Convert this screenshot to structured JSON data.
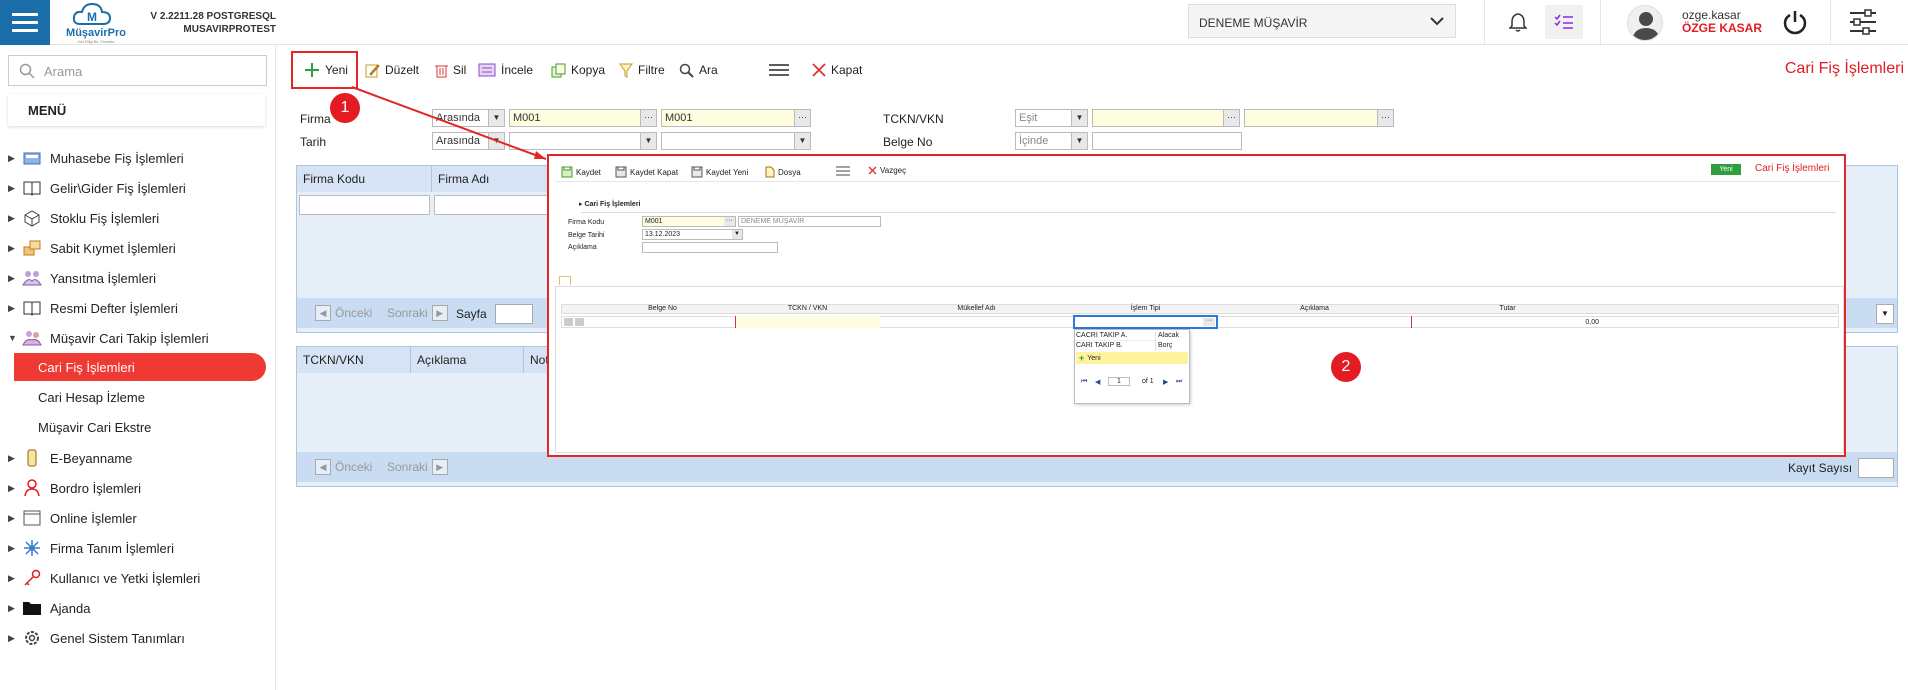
{
  "header": {
    "version_line1": "V 2.2211.28 POSTGRESQL",
    "version_line2": "MUSAVIRPROTEST",
    "brand": "MüşavirPro",
    "brand_tag": "Her Bilgi Bir Yönetim",
    "firm_select": "DENEME MÜŞAVİR",
    "user_login": "ozge.kasar",
    "user_full": "ÖZGE KASAR"
  },
  "sidebar": {
    "search_placeholder": "Arama",
    "menu_title": "MENÜ",
    "items": [
      {
        "label": "Muhasebe Fiş İşlemleri",
        "icon": "calculator-icon"
      },
      {
        "label": "Gelir\\Gider Fiş İşlemleri",
        "icon": "book-icon"
      },
      {
        "label": "Stoklu Fiş İşlemleri",
        "icon": "box-icon"
      },
      {
        "label": "Sabit Kıymet İşlemleri",
        "icon": "assets-icon"
      },
      {
        "label": "Yansıtma İşlemleri",
        "icon": "reflect-icon"
      },
      {
        "label": "Resmi Defter İşlemleri",
        "icon": "ledger-icon"
      },
      {
        "label": "Müşavir Cari Takip İşlemleri",
        "icon": "users-icon"
      },
      {
        "label": "E-Beyanname",
        "icon": "phone-icon"
      },
      {
        "label": "Bordro İşlemleri",
        "icon": "person-icon"
      },
      {
        "label": "Online İşlemler",
        "icon": "window-icon"
      },
      {
        "label": "Firma Tanım İşlemleri",
        "icon": "network-icon"
      },
      {
        "label": "Kullanıcı ve Yetki İşlemleri",
        "icon": "key-icon"
      },
      {
        "label": "Ajanda",
        "icon": "folder-icon"
      },
      {
        "label": "Genel Sistem Tanımları",
        "icon": "gear-icon"
      }
    ],
    "subitems": [
      "Cari Fiş İşlemleri",
      "Cari Hesap İzleme",
      "Müşavir Cari Ekstre"
    ]
  },
  "toolbar": {
    "new": "Yeni",
    "edit": "Düzelt",
    "delete": "Sil",
    "inspect": "İncele",
    "copy": "Kopya",
    "filter": "Filtre",
    "search": "Ara",
    "close": "Kapat",
    "page_title": "Cari Fiş İşlemleri"
  },
  "badges": {
    "one": "1",
    "two": "2"
  },
  "filter": {
    "firma_label": "Firma",
    "tarih_label": "Tarih",
    "firma_op": "Arasında",
    "tarih_op": "Arasında",
    "firma_from": "M001",
    "firma_to": "M001",
    "tckn_label": "TCKN/VKN",
    "tckn_op": "Eşit",
    "belge_label": "Belge No",
    "belge_op": "İçinde"
  },
  "grid1": {
    "headers": [
      "Firma Kodu",
      "Firma Adı"
    ],
    "prev": "Önceki",
    "next": "Sonraki",
    "page": "Sayfa"
  },
  "grid2": {
    "headers": [
      "TCKN/VKN",
      "Açıklama",
      "Not"
    ],
    "prev": "Önceki",
    "next": "Sonraki",
    "count_label": "Kayıt Sayısı"
  },
  "modal": {
    "save": "Kaydet",
    "save_close": "Kaydet Kapat",
    "save_new": "Kaydet Yeni",
    "file": "Dosya",
    "cancel": "Vazgeç",
    "status": "Yeni",
    "title": "Cari Fiş İşlemleri",
    "section": "Cari Fiş İşlemleri",
    "firma_kodu_label": "Firma Kodu",
    "firma_kodu_value": "M001",
    "firma_name": "DENEME MÜŞAVİR",
    "belge_tarihi_label": "Belge Tarihi",
    "belge_tarihi_value": "13.12.2023",
    "aciklama_label": "Açıklama",
    "columns": [
      "Belge No",
      "TCKN / VKN",
      "Mükellef Adı",
      "İşlem Tipi",
      "Açıklama",
      "Tutar"
    ],
    "row_amount": "0,00",
    "dropdown": {
      "rows": [
        {
          "name": "CACRI TAKIP A.",
          "type": "Alacak"
        },
        {
          "name": "CARI TAKIP B.",
          "type": "Borç"
        }
      ],
      "new_label": "Yeni",
      "page": "1",
      "of": "of 1"
    }
  },
  "colors": {
    "primary": "#1a6ea9",
    "accent": "#e31b23",
    "active": "#ee3a32"
  }
}
